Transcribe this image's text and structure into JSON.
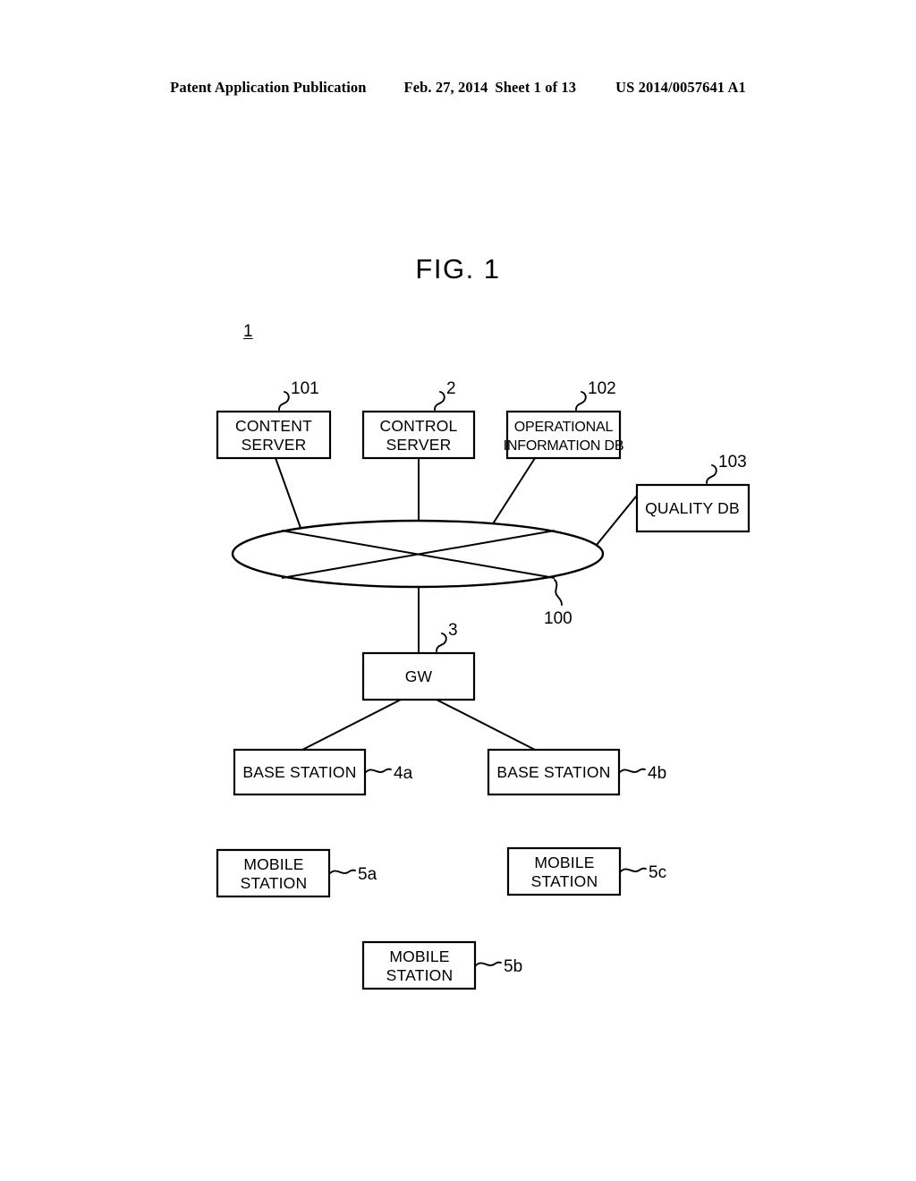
{
  "header": {
    "publication": "Patent Application Publication",
    "date": "Feb. 27, 2014",
    "sheet": "Sheet 1 of 13",
    "patent_number": "US 2014/0057641 A1"
  },
  "figure": {
    "title": "FIG. 1",
    "system_numeral": "1"
  },
  "diagram": {
    "type": "block-diagram",
    "nodes": [
      {
        "id": "content_server",
        "label_line1": "CONTENT",
        "label_line2": "SERVER",
        "ref": "101"
      },
      {
        "id": "control_server",
        "label_line1": "CONTROL",
        "label_line2": "SERVER",
        "ref": "2"
      },
      {
        "id": "operational_db",
        "label_line1": "OPERATIONAL",
        "label_line2": "INFORMATION DB",
        "ref": "102"
      },
      {
        "id": "quality_db",
        "label_line1": "QUALITY DB",
        "label_line2": "",
        "ref": "103"
      },
      {
        "id": "network",
        "label_line1": "",
        "label_line2": "",
        "ref": "100"
      },
      {
        "id": "gateway",
        "label_line1": "GW",
        "label_line2": "",
        "ref": "3"
      },
      {
        "id": "base_station_a",
        "label_line1": "BASE STATION",
        "label_line2": "",
        "ref": "4a"
      },
      {
        "id": "base_station_b",
        "label_line1": "BASE STATION",
        "label_line2": "",
        "ref": "4b"
      },
      {
        "id": "mobile_station_a",
        "label_line1": "MOBILE",
        "label_line2": "STATION",
        "ref": "5a"
      },
      {
        "id": "mobile_station_b",
        "label_line1": "MOBILE",
        "label_line2": "STATION",
        "ref": "5b"
      },
      {
        "id": "mobile_station_c",
        "label_line1": "MOBILE",
        "label_line2": "STATION",
        "ref": "5c"
      }
    ],
    "edges": [
      {
        "from": "content_server",
        "to": "network"
      },
      {
        "from": "control_server",
        "to": "network"
      },
      {
        "from": "operational_db",
        "to": "network"
      },
      {
        "from": "quality_db",
        "to": "network"
      },
      {
        "from": "network",
        "to": "gateway"
      },
      {
        "from": "gateway",
        "to": "base_station_a"
      },
      {
        "from": "gateway",
        "to": "base_station_b"
      }
    ],
    "colors": {
      "stroke": "#000000",
      "fill": "#ffffff",
      "background": "#ffffff"
    }
  }
}
